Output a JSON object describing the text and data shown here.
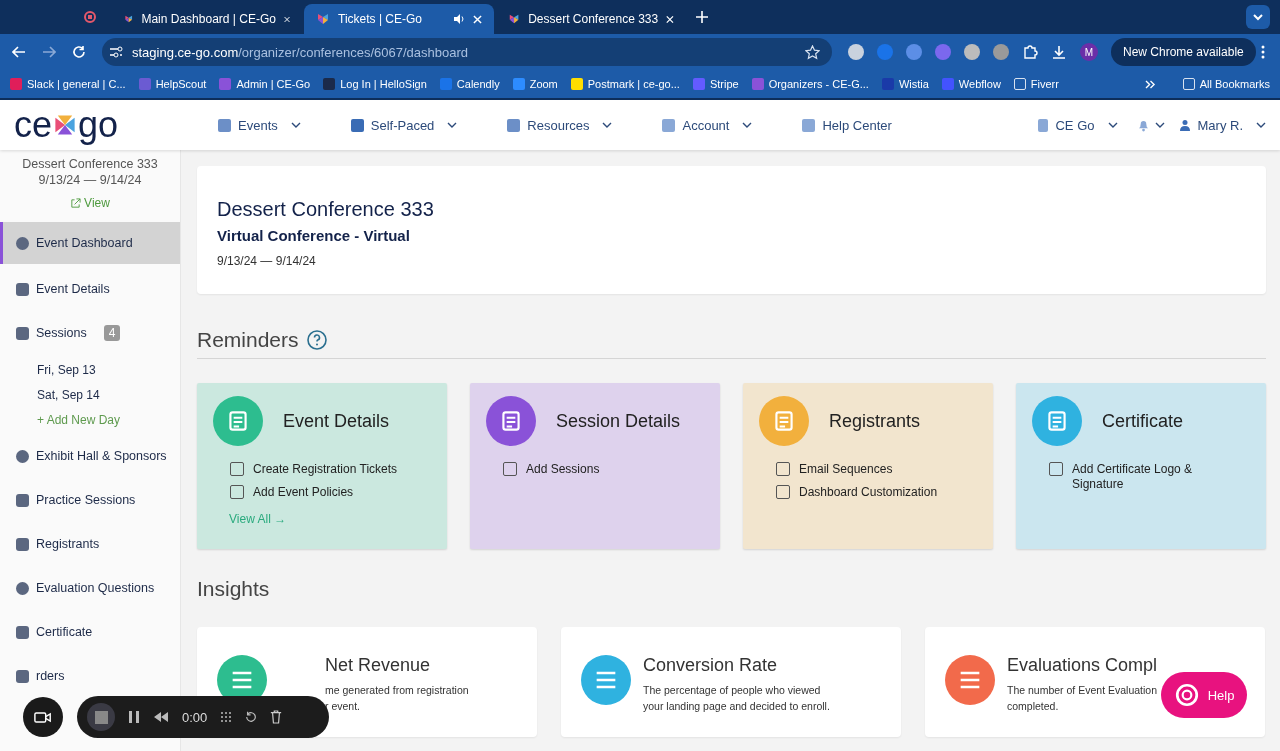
{
  "browser": {
    "tabs": [
      {
        "title": "Main Dashboard | CE-Go",
        "selected": false,
        "audio": false
      },
      {
        "title": "Tickets | CE-Go",
        "selected": true,
        "audio": true
      },
      {
        "title": "Dessert Conference 333",
        "selected": false,
        "audio": false
      }
    ],
    "address": {
      "domain": "staging.ce-go.com",
      "path": "/organizer/conferences/6067/dashboard"
    },
    "profile": "M",
    "update_button": "New Chrome available",
    "bookmarks": [
      "Slack | general | C...",
      "HelpScout",
      "Admin | CE-Go",
      "Log In | HelloSign",
      "Calendly",
      "Zoom",
      "Postmark | ce-go...",
      "Stripe",
      "Organizers - CE-G...",
      "Wistia",
      "Webflow",
      "Fiverr"
    ],
    "all_bookmarks": "All Bookmarks"
  },
  "header": {
    "logo": {
      "left": "ce",
      "right": "go"
    },
    "nav": [
      {
        "label": "Events",
        "dropdown": true
      },
      {
        "label": "Self-Paced",
        "dropdown": true
      },
      {
        "label": "Resources",
        "dropdown": true
      },
      {
        "label": "Account",
        "dropdown": true
      },
      {
        "label": "Help Center",
        "dropdown": false
      }
    ],
    "org": "CE Go",
    "user": "Mary R."
  },
  "sidebar": {
    "event_title": "Dessert Conference 333",
    "dates": "9/13/24 — 9/14/24",
    "view_link": "View",
    "items": [
      {
        "label": "Event Dashboard",
        "selected": true
      },
      {
        "label": "Event Details",
        "selected": false
      },
      {
        "label": "Sessions",
        "selected": false,
        "badge": "4",
        "children": [
          {
            "label": "Fri, Sep 13"
          },
          {
            "label": "Sat, Sep 14"
          }
        ],
        "add_link": "+ Add New Day"
      },
      {
        "label": "Exhibit Hall & Sponsors",
        "selected": false
      },
      {
        "label": "Practice Sessions",
        "selected": false
      },
      {
        "label": "Registrants",
        "selected": false
      },
      {
        "label": "Evaluation Questions",
        "selected": false
      },
      {
        "label": "Certificate",
        "selected": false
      },
      {
        "label": "rders",
        "selected": false
      }
    ]
  },
  "event": {
    "title": "Dessert Conference 333",
    "subtitle": "Virtual Conference - Virtual",
    "dates": "9/13/24 — 9/14/24"
  },
  "reminders": {
    "heading": "Reminders",
    "cards": [
      {
        "title": "Event Details",
        "color": "#2dbd8f",
        "items": [
          {
            "label": "Create Registration Tickets",
            "checked": false
          },
          {
            "label": "Add Event Policies",
            "checked": false
          }
        ],
        "link": "View All →"
      },
      {
        "title": "Session Details",
        "color": "#8a52d8",
        "items": [
          {
            "label": "Add Sessions",
            "checked": false
          }
        ]
      },
      {
        "title": "Registrants",
        "color": "#f2b03d",
        "items": [
          {
            "label": "Email Sequences",
            "checked": false
          },
          {
            "label": "Dashboard Customization",
            "checked": false
          }
        ]
      },
      {
        "title": "Certificate",
        "color": "#2fb2e0",
        "items": [
          {
            "label": "Add Certificate Logo & Signature",
            "checked": false
          }
        ]
      }
    ]
  },
  "insights": {
    "heading": "Insights",
    "cards": [
      {
        "title": "Net Revenue",
        "lines": [
          "me generated from registration",
          "r event."
        ]
      },
      {
        "title": "Conversion Rate",
        "lines": [
          "The percentage of people who viewed",
          "your landing page and decided to enroll."
        ]
      },
      {
        "title": "Evaluations Compl",
        "lines": [
          "The number of Event Evaluation",
          "completed."
        ]
      }
    ]
  },
  "recorder": {
    "time": "0:00"
  },
  "help_button": "Help"
}
